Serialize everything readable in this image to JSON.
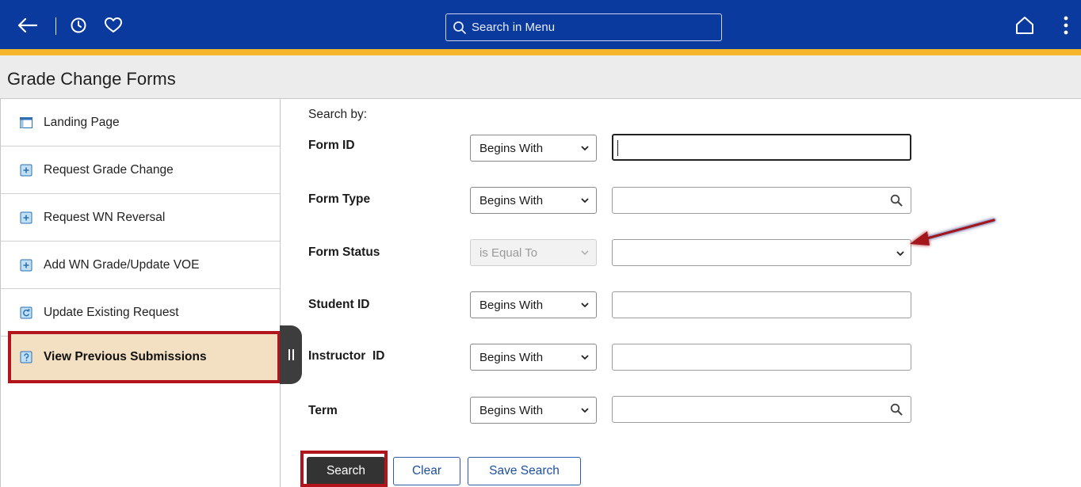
{
  "header": {
    "menu_search_placeholder": "Search in Menu",
    "back_icon": "back-arrow-icon",
    "recent_icon": "clock-icon",
    "favorites_icon": "heart-icon",
    "home_icon": "home-icon",
    "more_icon": "kebab-menu-icon",
    "banner_color": "#0a3a9e",
    "stripe_color": "#f5b52c"
  },
  "page": {
    "title": "Grade Change Forms"
  },
  "sidebar": {
    "items": [
      {
        "label": "Landing Page",
        "icon": "page-icon",
        "active": false
      },
      {
        "label": "Request Grade Change",
        "icon": "add-page-icon",
        "active": false
      },
      {
        "label": "Request WN Reversal",
        "icon": "add-page-icon",
        "active": false
      },
      {
        "label": "Add WN Grade/Update VOE",
        "icon": "add-page-icon",
        "active": false
      },
      {
        "label": "Update Existing Request",
        "icon": "update-page-icon",
        "active": false
      },
      {
        "label": "View Previous Submissions",
        "icon": "history-page-icon",
        "active": true
      }
    ],
    "highlight_color": "#b2141b"
  },
  "search": {
    "heading": "Search by:",
    "fields": [
      {
        "label": "Form ID",
        "operator": "Begins With",
        "value": ""
      },
      {
        "label": "Form Type",
        "operator": "Begins With",
        "value": ""
      },
      {
        "label": "Form Status",
        "operator": "is Equal To",
        "value": ""
      },
      {
        "label": "Student ID",
        "operator": "Begins With",
        "value": ""
      },
      {
        "label": "Instructor  ID",
        "operator": "Begins With",
        "value": ""
      },
      {
        "label": "Term",
        "operator": "Begins With",
        "value": ""
      }
    ],
    "buttons": {
      "search": "Search",
      "clear": "Clear",
      "save_search": "Save Search"
    }
  }
}
